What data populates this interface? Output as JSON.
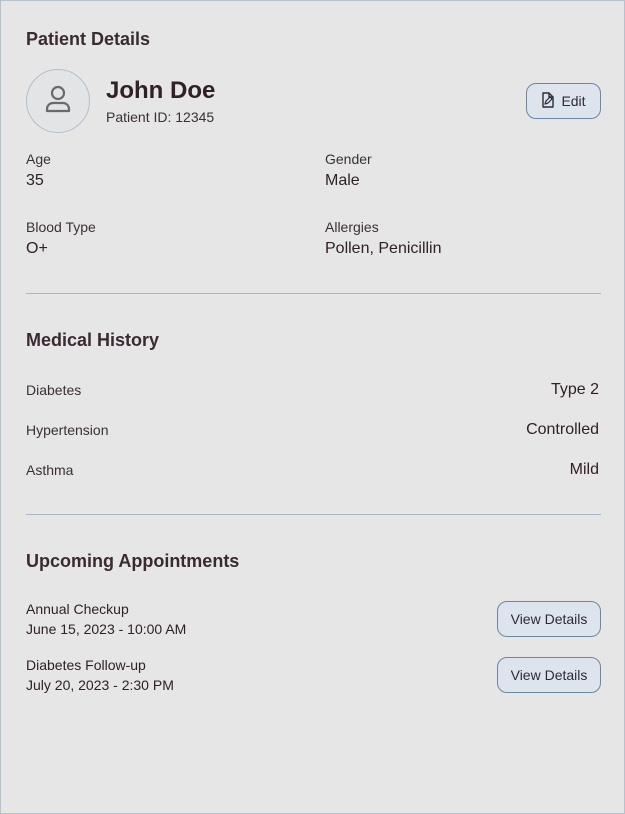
{
  "patient_details": {
    "heading": "Patient Details",
    "name": "John Doe",
    "patient_id": "Patient ID: 12345",
    "edit_label": "Edit",
    "fields": {
      "age_label": "Age",
      "age_value": "35",
      "gender_label": "Gender",
      "gender_value": "Male",
      "blood_label": "Blood Type",
      "blood_value": "O+",
      "allergies_label": "Allergies",
      "allergies_value": "Pollen, Penicillin"
    }
  },
  "medical_history": {
    "heading": "Medical History",
    "items": [
      {
        "label": "Diabetes",
        "value": "Type 2"
      },
      {
        "label": "Hypertension",
        "value": "Controlled"
      },
      {
        "label": "Asthma",
        "value": "Mild"
      }
    ]
  },
  "appointments": {
    "heading": "Upcoming Appointments",
    "items": [
      {
        "title": "Annual Checkup",
        "datetime": "June 15, 2023 - 10:00 AM",
        "button": "View Details"
      },
      {
        "title": "Diabetes Follow-up",
        "datetime": "July 20, 2023 - 2:30 PM",
        "button": "View Details"
      }
    ]
  },
  "icons": {
    "avatar": "user-icon",
    "edit": "edit-document-icon"
  },
  "colors": {
    "accent_border": "#6f86a3",
    "button_bg": "#dde4ee",
    "text": "#2f2127"
  }
}
